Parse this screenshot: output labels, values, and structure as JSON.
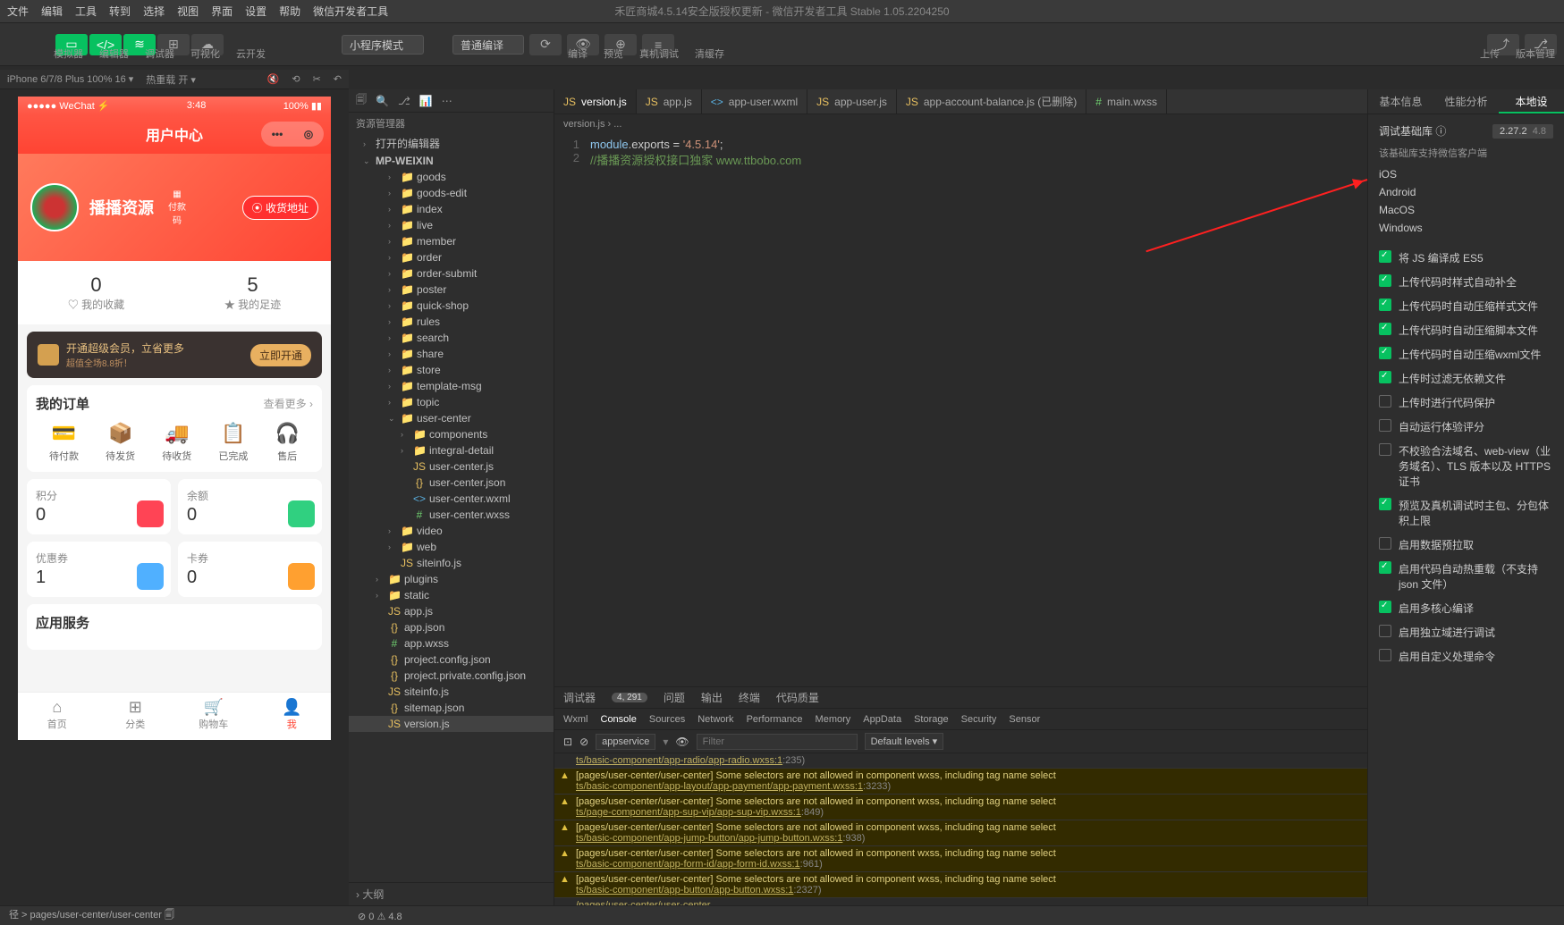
{
  "window_title": "禾匠商城4.5.14安全版授权更新 - 微信开发者工具 Stable 1.05.2204250",
  "menubar": [
    "文件",
    "编辑",
    "工具",
    "转到",
    "选择",
    "视图",
    "界面",
    "设置",
    "帮助",
    "微信开发者工具"
  ],
  "toolbar_labels": {
    "simulator": "模拟器",
    "editor": "编辑器",
    "debugger": "调试器",
    "visual": "可视化",
    "cloud": "云开发"
  },
  "toolbar_selects": {
    "mode": "小程序模式",
    "compile": "普通编译"
  },
  "toolbar_center": {
    "compile_lbl": "编译",
    "preview_lbl": "预览",
    "remote_lbl": "真机调试",
    "cache_lbl": "清缓存"
  },
  "toolbar_right": {
    "upload": "上传",
    "version": "版本管理"
  },
  "sim_bar": {
    "device": "iPhone 6/7/8 Plus 100% 16 ▾",
    "reload": "热重载 开 ▾"
  },
  "phone": {
    "status_left": "●●●●● WeChat ⚡",
    "status_time": "3:48",
    "status_right": "100% ▮▮",
    "nav_title": "用户中心",
    "user_name": "播播资源",
    "qr_label": "付款码",
    "addr_btn": "⦿ 收货地址",
    "stat1_n": "0",
    "stat1_l": "♡ 我的收藏",
    "stat2_n": "5",
    "stat2_l": "★ 我的足迹",
    "vip_t1": "开通超级会员，立省更多",
    "vip_t2": "超值全场8.8折！",
    "vip_btn": "立即开通",
    "orders_title": "我的订单",
    "orders_more": "查看更多 ›",
    "orders": [
      {
        "i": "💳",
        "l": "待付款"
      },
      {
        "i": "📦",
        "l": "待发货"
      },
      {
        "i": "🚚",
        "l": "待收货"
      },
      {
        "i": "📋",
        "l": "已完成"
      },
      {
        "i": "🎧",
        "l": "售后"
      }
    ],
    "g1_l": "积分",
    "g1_v": "0",
    "g2_l": "余额",
    "g2_v": "0",
    "g3_l": "优惠券",
    "g3_v": "1",
    "g4_l": "卡券",
    "g4_v": "0",
    "svc_title": "应用服务",
    "tabs": [
      {
        "i": "⌂",
        "l": "首页"
      },
      {
        "i": "⊞",
        "l": "分类"
      },
      {
        "i": "🛒",
        "l": "购物车"
      },
      {
        "i": "👤",
        "l": "我"
      }
    ]
  },
  "explorer": {
    "title": "资源管理器",
    "root1": "打开的编辑器",
    "root2": "MP-WEIXIN",
    "nodes": [
      {
        "d": 3,
        "t": "folder",
        "n": "goods",
        "a": "›"
      },
      {
        "d": 3,
        "t": "folder",
        "n": "goods-edit",
        "a": "›"
      },
      {
        "d": 3,
        "t": "folder",
        "n": "index",
        "a": "›"
      },
      {
        "d": 3,
        "t": "folder",
        "n": "live",
        "a": "›"
      },
      {
        "d": 3,
        "t": "folder",
        "n": "member",
        "a": "›"
      },
      {
        "d": 3,
        "t": "folder",
        "n": "order",
        "a": "›"
      },
      {
        "d": 3,
        "t": "folder",
        "n": "order-submit",
        "a": "›"
      },
      {
        "d": 3,
        "t": "folder",
        "n": "poster",
        "a": "›"
      },
      {
        "d": 3,
        "t": "folder",
        "n": "quick-shop",
        "a": "›"
      },
      {
        "d": 3,
        "t": "folder",
        "n": "rules",
        "a": "›"
      },
      {
        "d": 3,
        "t": "folder",
        "n": "search",
        "a": "›"
      },
      {
        "d": 3,
        "t": "folder",
        "n": "share",
        "a": "›"
      },
      {
        "d": 3,
        "t": "folder",
        "n": "store",
        "a": "›"
      },
      {
        "d": 3,
        "t": "folder",
        "n": "template-msg",
        "a": "›"
      },
      {
        "d": 3,
        "t": "folder",
        "n": "topic",
        "a": "›"
      },
      {
        "d": 3,
        "t": "folder",
        "n": "user-center",
        "a": "⌄",
        "open": true
      },
      {
        "d": 4,
        "t": "folder",
        "n": "components",
        "a": "›"
      },
      {
        "d": 4,
        "t": "folder",
        "n": "integral-detail",
        "a": "›"
      },
      {
        "d": 4,
        "t": "js",
        "n": "user-center.js"
      },
      {
        "d": 4,
        "t": "json",
        "n": "user-center.json"
      },
      {
        "d": 4,
        "t": "wxml",
        "n": "user-center.wxml"
      },
      {
        "d": 4,
        "t": "wxss",
        "n": "user-center.wxss"
      },
      {
        "d": 3,
        "t": "folder",
        "n": "video",
        "a": "›"
      },
      {
        "d": 3,
        "t": "folder",
        "n": "web",
        "a": "›"
      },
      {
        "d": 3,
        "t": "js",
        "n": "siteinfo.js"
      },
      {
        "d": 2,
        "t": "folder",
        "n": "plugins",
        "a": "›"
      },
      {
        "d": 2,
        "t": "folder",
        "n": "static",
        "a": "›"
      },
      {
        "d": 2,
        "t": "js",
        "n": "app.js"
      },
      {
        "d": 2,
        "t": "json",
        "n": "app.json"
      },
      {
        "d": 2,
        "t": "wxss",
        "n": "app.wxss"
      },
      {
        "d": 2,
        "t": "json",
        "n": "project.config.json"
      },
      {
        "d": 2,
        "t": "json",
        "n": "project.private.config.json"
      },
      {
        "d": 2,
        "t": "js",
        "n": "siteinfo.js"
      },
      {
        "d": 2,
        "t": "json",
        "n": "sitemap.json"
      },
      {
        "d": 2,
        "t": "js",
        "n": "version.js",
        "sel": true
      }
    ],
    "outline": "大纲"
  },
  "editor": {
    "tabs": [
      {
        "label": "app.js",
        "icon": "js"
      },
      {
        "label": "app-user.wxml",
        "icon": "wxml"
      },
      {
        "label": "app-user.js",
        "icon": "js"
      },
      {
        "label": "app-account-balance.js (已删除)",
        "icon": "js"
      },
      {
        "label": "main.wxss",
        "icon": "wxss"
      }
    ],
    "active_tab": "version.js",
    "crumb": "version.js › ...",
    "line1_a": "module",
    "line1_b": ".exports ",
    "line1_c": "= ",
    "line1_d": "'4.5.14'",
    "line1_e": ";",
    "line2": "//播播资源授权接口独家 www.ttbobo.com"
  },
  "console": {
    "tabs1": {
      "debugger": "调试器",
      "count": "4, 291",
      "problems": "问题",
      "output": "输出",
      "terminal": "终端",
      "quality": "代码质量"
    },
    "tabs2": [
      "Wxml",
      "Console",
      "Sources",
      "Network",
      "Performance",
      "Memory",
      "AppData",
      "Storage",
      "Security",
      "Sensor"
    ],
    "tabs2_active": "Console",
    "filter_ctx": "appservice",
    "filter_placeholder": "Filter",
    "levels": "Default levels ▾",
    "messages": [
      {
        "warn": false,
        "text": "ts/basic-component/app-radio/app-radio.wxss:1",
        "loc": ":235)"
      },
      {
        "warn": true,
        "text": "[pages/user-center/user-center] Some selectors are not allowed in component wxss, including tag name select",
        "link": "ts/basic-component/app-layout/app-payment/app-payment.wxss:1",
        "loc": ":3233)"
      },
      {
        "warn": true,
        "text": "[pages/user-center/user-center] Some selectors are not allowed in component wxss, including tag name select",
        "link": "ts/page-component/app-sup-vip/app-sup-vip.wxss:1",
        "loc": ":849)"
      },
      {
        "warn": true,
        "text": "[pages/user-center/user-center] Some selectors are not allowed in component wxss, including tag name select",
        "link": "ts/basic-component/app-jump-button/app-jump-button.wxss:1",
        "loc": ":938)"
      },
      {
        "warn": true,
        "text": "[pages/user-center/user-center] Some selectors are not allowed in component wxss, including tag name select",
        "link": "ts/basic-component/app-form-id/app-form-id.wxss:1",
        "loc": ":961)"
      },
      {
        "warn": true,
        "text": "[pages/user-center/user-center] Some selectors are not allowed in component wxss, including tag name select",
        "link": "ts/basic-component/app-button/app-button.wxss:1",
        "loc": ":2327)"
      },
      {
        "warn": false,
        "text": "/pages/user-center/user-center"
      }
    ]
  },
  "right": {
    "tabs": [
      "基本信息",
      "性能分析",
      "本地设"
    ],
    "active": "本地设",
    "lib_label": "调试基础库 ⓘ",
    "lib_ver": "2.27.2",
    "lib_pct": "4.8",
    "support": "该基础库支持微信客户端",
    "platforms": [
      "iOS",
      "Android",
      "MacOS",
      "Windows"
    ],
    "checks": [
      {
        "on": true,
        "t": "将 JS 编译成 ES5"
      },
      {
        "on": true,
        "t": "上传代码时样式自动补全"
      },
      {
        "on": true,
        "t": "上传代码时自动压缩样式文件"
      },
      {
        "on": true,
        "t": "上传代码时自动压缩脚本文件"
      },
      {
        "on": true,
        "t": "上传代码时自动压缩wxml文件"
      },
      {
        "on": true,
        "t": "上传时过滤无依赖文件"
      },
      {
        "on": false,
        "t": "上传时进行代码保护"
      },
      {
        "on": false,
        "t": "自动运行体验评分"
      },
      {
        "on": false,
        "t": "不校验合法域名、web-view（业务域名）、TLS 版本以及 HTTPS 证书"
      },
      {
        "on": true,
        "t": "预览及真机调试时主包、分包体积上限"
      },
      {
        "on": false,
        "t": "启用数据预拉取"
      },
      {
        "on": true,
        "t": "启用代码自动热重载（不支持 json 文件）"
      },
      {
        "on": true,
        "t": "启用多核心编译"
      },
      {
        "on": false,
        "t": "启用独立域进行调试"
      },
      {
        "on": false,
        "t": "启用自定义处理命令"
      }
    ]
  },
  "status": {
    "path_prefix": "径 > ",
    "path": "pages/user-center/user-center",
    "errs": "⊘ 0 ⚠ 4.8"
  }
}
